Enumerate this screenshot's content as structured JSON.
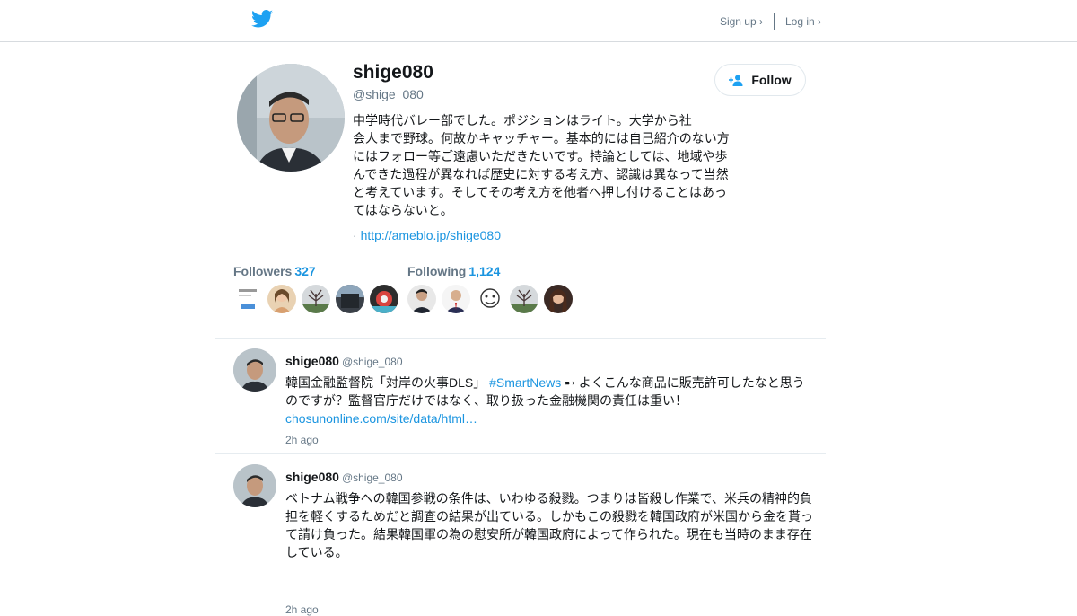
{
  "header": {
    "signup_label": "Sign up ›",
    "login_label": "Log in ›",
    "brand_color": "#1da1f2"
  },
  "profile": {
    "name": "shige080",
    "handle": "@shige_080",
    "follow_label": "Follow",
    "bio_lines": [
      "中学時代バレー部でした。ポジションはライト。大学から社",
      "会人まで野球。何故かキャッチャー。基本的には自己紹介のない方",
      "にはフォロー等ご遠慮いただきたいです。持論としては、地域や歩",
      "んできた過程が異なれば歴史に対する考え方、認識は異なって当然",
      "と考えています。そしてその考え方を他者へ押し付けることはあっ",
      "てはならないと。"
    ],
    "url_prefix": "·",
    "url": "http://ameblo.jp/shige080"
  },
  "stats": {
    "followers_label": "Followers",
    "followers_count": "327",
    "following_label": "Following",
    "following_count": "1,124"
  },
  "tweets": [
    {
      "name": "shige080",
      "handle": "@shige_080",
      "text_before": "韓国金融監督院「対岸の火事DLS」 ",
      "hashtag": "#SmartNews",
      "text_after": " ➸ よくこんな商品に販売許可したなと思うのですが？監督官庁だけではなく、取り扱った金融機関の責任は重い！",
      "link": "chosunonline.com/site/data/html…",
      "time": "2h ago"
    },
    {
      "name": "shige080",
      "handle": "@shige_080",
      "text": "ベトナム戦争への韓国参戦の条件は、いわゆる殺戮。つまりは皆殺し作業で、米兵の精神的負担を軽くするためだと調査の結果が出ている。しかもこの殺戮を韓国政府が米国から金を貰って請け負った。結果韓国軍の為の慰安所が韓国政府によって作られた。現在も当時のまま存在している。",
      "time": "2h ago"
    }
  ]
}
